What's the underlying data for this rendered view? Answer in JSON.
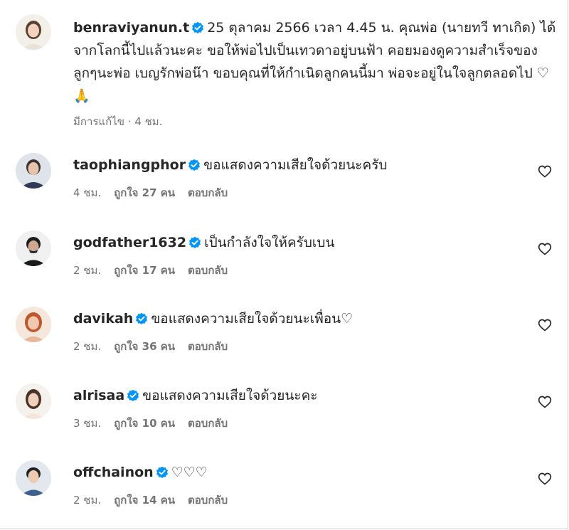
{
  "caption": {
    "username": "benraviyanun.t",
    "text": "25 ตุลาคม 2566 เวลา 4.45 น. คุณพ่อ (นายทวี ทาเกิด) ได้จากโลกนี้ไปแล้วนะคะ ขอให้พ่อไปเป็นเทวดาอยู่บนฟ้า คอยมองดูความสำเร็จของลูกๆนะพ่อ เบญรักพ่อน๊า ขอบคุณที่ให้กำเนิดลูกคนนี้มา พ่อจะอยู่ในใจลูกตลอดไป",
    "emojis": "♡ 🙏",
    "edited": "มีการแก้ไข",
    "time": "4 ชม."
  },
  "comments": [
    {
      "username": "taophiangphor",
      "text": "ขอแสดงความเสียใจด้วยนะครับ",
      "time": "4 ชม.",
      "likes": "ถูกใจ 27 คน",
      "reply": "ตอบกลับ"
    },
    {
      "username": "godfather1632",
      "text": "เป็นกำลังใจให้ครับเบน",
      "time": "2 ชม.",
      "likes": "ถูกใจ 17 คน",
      "reply": "ตอบกลับ"
    },
    {
      "username": "davikah",
      "text": "ขอแสดงความเสียใจด้วยนะเพื่อน♡",
      "time": "2 ชม.",
      "likes": "ถูกใจ 36 คน",
      "reply": "ตอบกลับ"
    },
    {
      "username": "alrisaa",
      "text": "ขอแสดงความเสียใจด้วยนะคะ",
      "time": "3 ชม.",
      "likes": "ถูกใจ 10 คน",
      "reply": "ตอบกลับ"
    },
    {
      "username": "offchainon",
      "text": "♡♡♡",
      "time": "2 ชม.",
      "likes": "ถูกใจ 14 คน",
      "reply": "ตอบกลับ"
    }
  ],
  "colors": {
    "verified": "#0095f6",
    "text": "#262626",
    "meta": "#737373"
  }
}
